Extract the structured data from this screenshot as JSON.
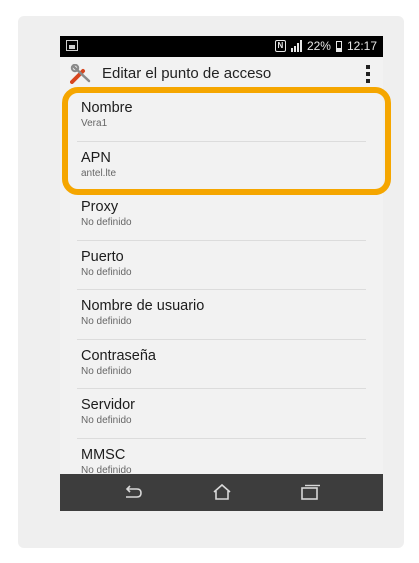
{
  "status_bar": {
    "battery_percent": "22%",
    "time": "12:17",
    "nfc_icon": "N"
  },
  "app_bar": {
    "title": "Editar el punto de acceso"
  },
  "settings": [
    {
      "label": "Nombre",
      "value": "Vera1"
    },
    {
      "label": "APN",
      "value": "antel.lte"
    },
    {
      "label": "Proxy",
      "value": "No definido"
    },
    {
      "label": "Puerto",
      "value": "No definido"
    },
    {
      "label": "Nombre de usuario",
      "value": "No definido"
    },
    {
      "label": "Contraseña",
      "value": "No definido"
    },
    {
      "label": "Servidor",
      "value": "No definido"
    },
    {
      "label": "MMSC",
      "value": "No definido"
    }
  ],
  "colors": {
    "highlight": "#f5a600",
    "navbar": "#3d3d3d",
    "statusbar": "#000000"
  }
}
